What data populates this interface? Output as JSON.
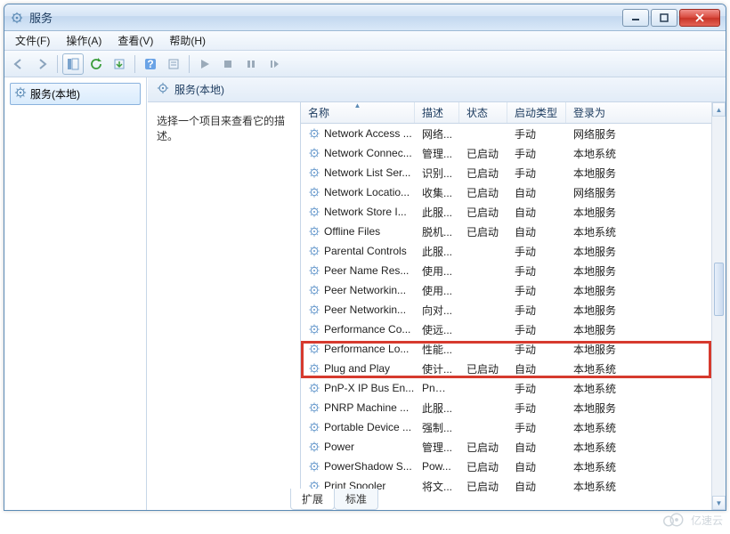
{
  "window": {
    "title": "服务"
  },
  "menu": {
    "file": "文件(F)",
    "action": "操作(A)",
    "view": "查看(V)",
    "help": "帮助(H)"
  },
  "tree": {
    "root": "服务(本地)"
  },
  "right_header": "服务(本地)",
  "detail_hint": "选择一个项目来查看它的描述。",
  "columns": {
    "name": "名称",
    "desc": "描述",
    "status": "状态",
    "startup": "启动类型",
    "logon": "登录为"
  },
  "tabs": {
    "extended": "扩展",
    "standard": "标准"
  },
  "watermark": "亿速云",
  "highlight_index": 11,
  "services": [
    {
      "name": "Network Access ...",
      "desc": "网络...",
      "status": "",
      "startup": "手动",
      "logon": "网络服务"
    },
    {
      "name": "Network Connec...",
      "desc": "管理...",
      "status": "已启动",
      "startup": "手动",
      "logon": "本地系统"
    },
    {
      "name": "Network List Ser...",
      "desc": "识别...",
      "status": "已启动",
      "startup": "手动",
      "logon": "本地服务"
    },
    {
      "name": "Network Locatio...",
      "desc": "收集...",
      "status": "已启动",
      "startup": "自动",
      "logon": "网络服务"
    },
    {
      "name": "Network Store I...",
      "desc": "此服...",
      "status": "已启动",
      "startup": "自动",
      "logon": "本地服务"
    },
    {
      "name": "Offline Files",
      "desc": "脱机...",
      "status": "已启动",
      "startup": "自动",
      "logon": "本地系统"
    },
    {
      "name": "Parental Controls",
      "desc": "此服...",
      "status": "",
      "startup": "手动",
      "logon": "本地服务"
    },
    {
      "name": "Peer Name Res...",
      "desc": "使用...",
      "status": "",
      "startup": "手动",
      "logon": "本地服务"
    },
    {
      "name": "Peer Networkin...",
      "desc": "使用...",
      "status": "",
      "startup": "手动",
      "logon": "本地服务"
    },
    {
      "name": "Peer Networkin...",
      "desc": "向对...",
      "status": "",
      "startup": "手动",
      "logon": "本地服务"
    },
    {
      "name": "Performance Co...",
      "desc": "使远...",
      "status": "",
      "startup": "手动",
      "logon": "本地服务"
    },
    {
      "name": "Performance Lo...",
      "desc": "性能...",
      "status": "",
      "startup": "手动",
      "logon": "本地服务"
    },
    {
      "name": "Plug and Play",
      "desc": "使计...",
      "status": "已启动",
      "startup": "自动",
      "logon": "本地系统"
    },
    {
      "name": "PnP-X IP Bus En...",
      "desc": "PnP-...",
      "status": "",
      "startup": "手动",
      "logon": "本地系统"
    },
    {
      "name": "PNRP Machine ...",
      "desc": "此服...",
      "status": "",
      "startup": "手动",
      "logon": "本地服务"
    },
    {
      "name": "Portable Device ...",
      "desc": "强制...",
      "status": "",
      "startup": "手动",
      "logon": "本地系统"
    },
    {
      "name": "Power",
      "desc": "管理...",
      "status": "已启动",
      "startup": "自动",
      "logon": "本地系统"
    },
    {
      "name": "PowerShadow S...",
      "desc": "Pow...",
      "status": "已启动",
      "startup": "自动",
      "logon": "本地系统"
    },
    {
      "name": "Print Spooler",
      "desc": "将文...",
      "status": "已启动",
      "startup": "自动",
      "logon": "本地系统"
    }
  ]
}
